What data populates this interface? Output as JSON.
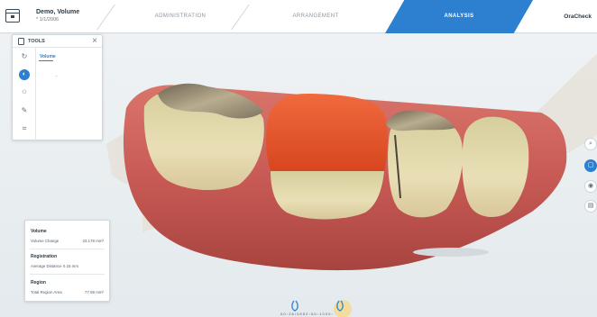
{
  "header": {
    "case_title": "Demo, Volume",
    "case_subtitle": "* 1/1/2006",
    "tabs": [
      {
        "label": "ADMINISTRATION",
        "active": false
      },
      {
        "label": "ARRANGEMENT",
        "active": false
      },
      {
        "label": "ANALYSIS",
        "active": true
      }
    ],
    "product_name": "OraCheck",
    "accent_color": "#2d7fd0"
  },
  "tools_panel": {
    "title": "TOOLS",
    "close_symbol": "×",
    "rail_icons": [
      "rotate-icon",
      "volume-tool-icon",
      "distance-tool-icon",
      "pen-tool-icon",
      "crop-tool-icon"
    ],
    "active_tool": "Volume",
    "faint_controls": "+ · ·"
  },
  "info_panel": {
    "volume": {
      "heading": "Volume",
      "label": "Volume Change",
      "value": "23.178 mm³"
    },
    "registration": {
      "heading": "Registration",
      "label": "Average Distance",
      "value": "0.15 mm"
    },
    "region": {
      "heading": "Region",
      "label": "Total Region Area",
      "value": "77.69 mm²"
    }
  },
  "side_controls": [
    "search-icon",
    "tooth-icon",
    "eye-icon",
    "image-icon"
  ],
  "bottom_strip": {
    "icons": [
      "tooth-outline-icon",
      "tooth-highlight-icon"
    ],
    "caption": "0.0 ▫ 2 6 / 0.9 5 2 ▫ 0.0 ▫ 1 0 0 0 ▫"
  },
  "scene_colors": {
    "gum": "#c85a55",
    "tooth": "#e7dcb2",
    "crown_overlay": "#e4542d",
    "metal": "#9a9077"
  }
}
